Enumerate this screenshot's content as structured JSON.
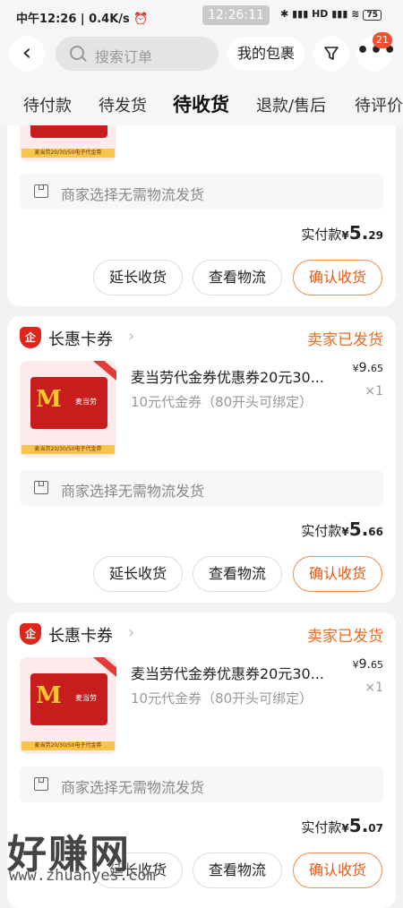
{
  "status_bar": {
    "left": "中午12:26 | 0.4K/s ⏰",
    "time": "12:26:11",
    "right": "✱ ▮▮▮ HD ▮▮▮ ≋",
    "battery": "75"
  },
  "header": {
    "search_placeholder": "搜索订单",
    "my_package": "我的包裹",
    "notification_count": "21"
  },
  "tabs": [
    {
      "label": "待付款",
      "active": false
    },
    {
      "label": "待发货",
      "active": false
    },
    {
      "label": "待收货",
      "active": true
    },
    {
      "label": "退款/售后",
      "active": false
    },
    {
      "label": "待评价",
      "active": false
    }
  ],
  "orders": [
    {
      "shop": "",
      "status": "",
      "product": {
        "title": "",
        "subtitle": "",
        "price_int": "",
        "price_dec": "",
        "qty": ""
      },
      "image_tag": "麦当劳20/30/50电子代金券",
      "shipping_note": "商家选择无需物流发货",
      "paid_label": "实付款",
      "paid_currency": "¥",
      "paid_int": "5.",
      "paid_dec": "29",
      "buttons": {
        "extend": "延长收货",
        "logistics": "查看物流",
        "confirm": "确认收货"
      }
    },
    {
      "shop": "长惠卡券",
      "status": "卖家已发货",
      "product": {
        "title": "麦当劳代金券优惠券20元30...",
        "subtitle": "10元代金券（80开头可绑定）",
        "price_cur": "¥",
        "price_int": "9.",
        "price_dec": "65",
        "qty": "×1"
      },
      "image_tag": "麦当劳20/30/50电子代金券",
      "shipping_note": "商家选择无需物流发货",
      "paid_label": "实付款",
      "paid_currency": "¥",
      "paid_int": "5.",
      "paid_dec": "66",
      "buttons": {
        "extend": "延长收货",
        "logistics": "查看物流",
        "confirm": "确认收货"
      }
    },
    {
      "shop": "长惠卡券",
      "status": "卖家已发货",
      "product": {
        "title": "麦当劳代金券优惠券20元30...",
        "subtitle": "10元代金券（80开头可绑定）",
        "price_cur": "¥",
        "price_int": "9.",
        "price_dec": "65",
        "qty": "×1"
      },
      "image_tag": "麦当劳20/30/50电子代金券",
      "shipping_note": "商家选择无需物流发货",
      "paid_label": "实付款",
      "paid_currency": "¥",
      "paid_int": "5.",
      "paid_dec": "07",
      "buttons": {
        "extend": "延长收货",
        "logistics": "查看物流",
        "confirm": "确认收货"
      }
    }
  ],
  "watermark": {
    "text": "好赚网",
    "url": "www.zhuanyes.com"
  }
}
